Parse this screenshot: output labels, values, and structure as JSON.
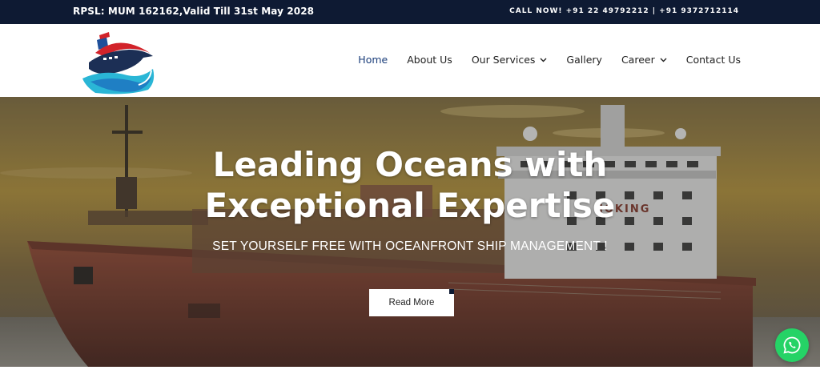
{
  "topbar": {
    "license": "RPSL: MUM 162162,Valid Till 31st May 2028",
    "call": "CALL NOW! +91 22 49792212 | +91 9372712114"
  },
  "header": {
    "logo": "company-ship-logo",
    "nav": [
      {
        "label": "Home",
        "active": true,
        "dropdown": false
      },
      {
        "label": "About Us",
        "active": false,
        "dropdown": false
      },
      {
        "label": "Our Services",
        "active": false,
        "dropdown": true
      },
      {
        "label": "Gallery",
        "active": false,
        "dropdown": false
      },
      {
        "label": "Career",
        "active": false,
        "dropdown": true
      },
      {
        "label": "Contact Us",
        "active": false,
        "dropdown": false
      }
    ]
  },
  "hero": {
    "title_line1": "Leading Oceans with",
    "title_line2": "Exceptional Expertise",
    "subtitle": "SET YOURSELF FREE WITH OCEANFRONT SHIP MANAGEMENT !",
    "button_label": "Read More",
    "ship_name": "HOKING"
  },
  "colors": {
    "topbar_bg": "#0e1a33",
    "nav_active": "#1a3d7a",
    "whatsapp": "#25d366",
    "logo_red": "#d2232a",
    "logo_blue": "#1f7fc4",
    "logo_teal": "#2ab6d6"
  },
  "icons": {
    "whatsapp": "whatsapp-icon",
    "dropdown": "chevron-down-icon"
  }
}
